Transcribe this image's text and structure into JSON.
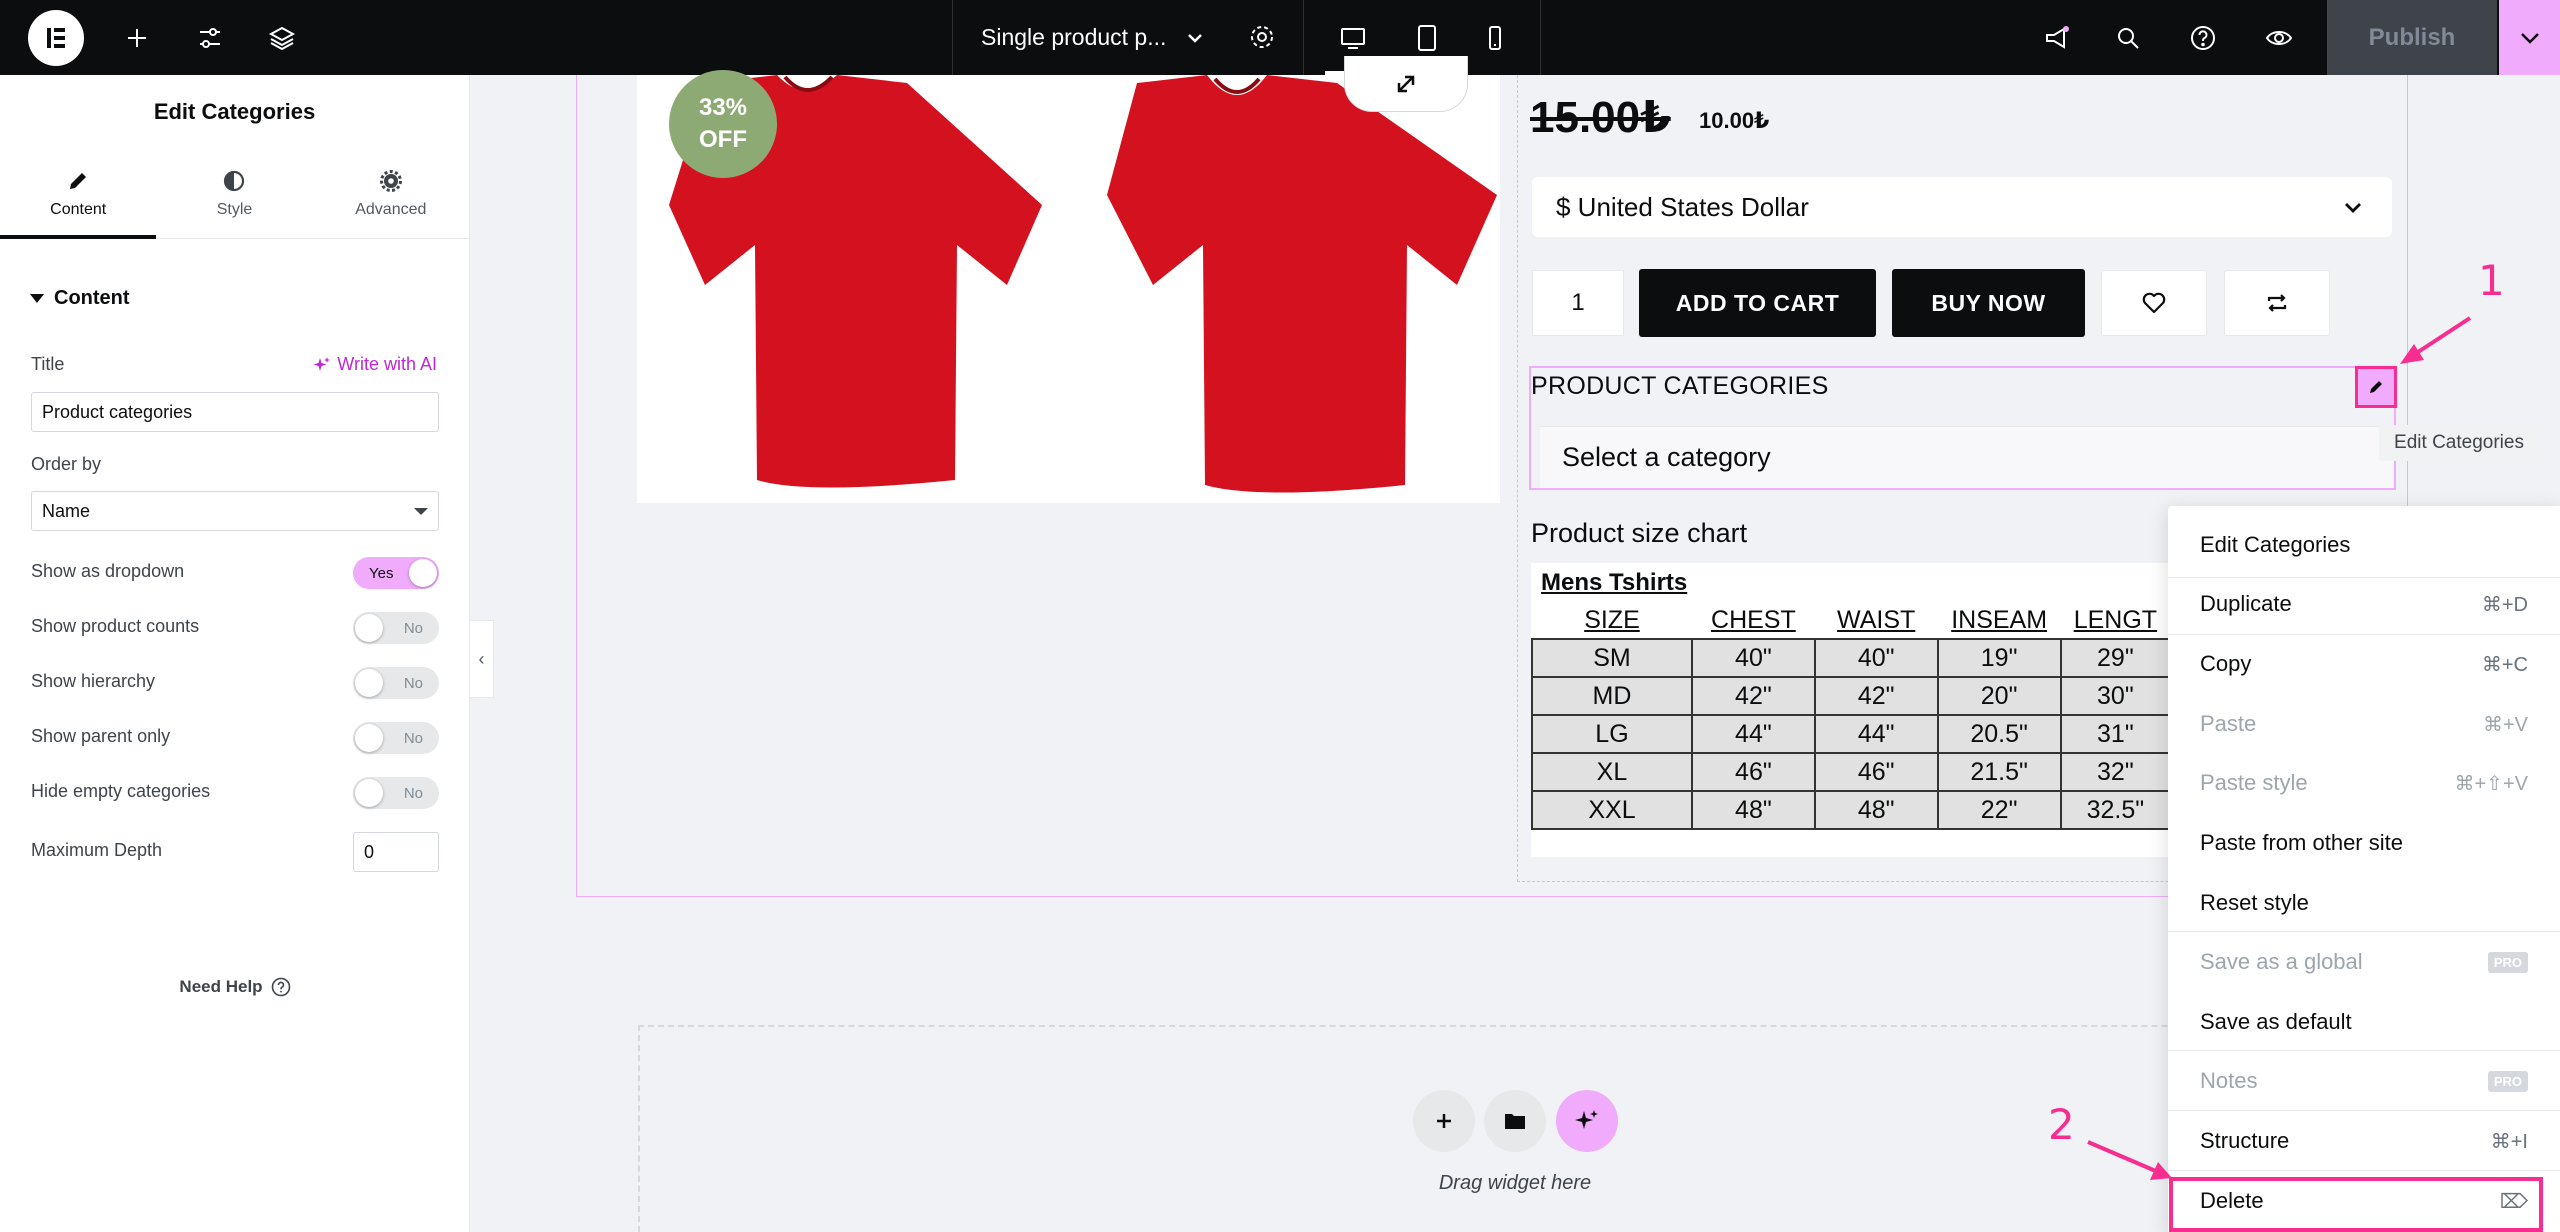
{
  "topbar": {
    "document_title": "Single product p...",
    "publish_label": "Publish",
    "icons": [
      "elementor-logo-icon",
      "add-icon",
      "sliders-icon",
      "layers-icon",
      "chevron-down-icon",
      "gear-icon",
      "desktop-icon",
      "tablet-icon",
      "mobile-icon",
      "megaphone-icon",
      "search-icon",
      "help-icon",
      "eye-icon",
      "chevron-down-icon"
    ],
    "colors": {
      "bg": "#0c0d0e",
      "publish_more": "#f0abfc"
    }
  },
  "panel": {
    "title": "Edit Categories",
    "tabs": [
      {
        "label": "Content",
        "icon": "pencil-icon",
        "active": true
      },
      {
        "label": "Style",
        "icon": "contrast-icon",
        "active": false
      },
      {
        "label": "Advanced",
        "icon": "gear-icon",
        "active": false
      }
    ],
    "section": "Content",
    "title_label": "Title",
    "ai_label": "Write with AI",
    "title_value": "Product categories",
    "order_label": "Order by",
    "order_value": "Name",
    "toggles": [
      {
        "label": "Show as dropdown",
        "value": "Yes",
        "on": true
      },
      {
        "label": "Show product counts",
        "value": "No",
        "on": false
      },
      {
        "label": "Show hierarchy",
        "value": "No",
        "on": false
      },
      {
        "label": "Show parent only",
        "value": "No",
        "on": false
      },
      {
        "label": "Hide empty categories",
        "value": "No",
        "on": false
      }
    ],
    "depth_label": "Maximum Depth",
    "depth_value": "0",
    "help_label": "Need Help",
    "collapse_glyph": "‹"
  },
  "product": {
    "badge_line1": "33%",
    "badge_line2": "OFF",
    "price_old": "15.00₺",
    "price_new": "10.00₺",
    "currency": "$ United States Dollar",
    "qty": "1",
    "add_to_cart": "ADD TO CART",
    "buy_now": "BUY NOW",
    "categories_title": "PRODUCT CATEGORIES",
    "categories_placeholder": "Select a category",
    "edit_tooltip": "Edit Categories",
    "size_chart_title": "Product size chart",
    "size_chart_heading": "Mens Tshirts",
    "size_table": {
      "headers": [
        "SIZE",
        "CHEST",
        "WAIST",
        "INSEAM",
        "LENGT"
      ],
      "rows": [
        [
          "SM",
          "40\"",
          "40\"",
          "19\"",
          "29\""
        ],
        [
          "MD",
          "42\"",
          "42\"",
          "20\"",
          "30\""
        ],
        [
          "LG",
          "44\"",
          "44\"",
          "20.5\"",
          "31\""
        ],
        [
          "XL",
          "46\"",
          "46\"",
          "21.5\"",
          "32\""
        ],
        [
          "XXL",
          "48\"",
          "48\"",
          "22\"",
          "32.5\""
        ]
      ]
    },
    "drag_text": "Drag widget here"
  },
  "context_menu": {
    "items": [
      {
        "label": "Edit Categories",
        "shortcut": "",
        "disabled": false
      },
      {
        "label": "Duplicate",
        "shortcut": "⌘+D",
        "disabled": false
      },
      {
        "label": "Copy",
        "shortcut": "⌘+C",
        "disabled": false
      },
      {
        "label": "Paste",
        "shortcut": "⌘+V",
        "disabled": true
      },
      {
        "label": "Paste style",
        "shortcut": "⌘+⇧+V",
        "disabled": true
      },
      {
        "label": "Paste from other site",
        "shortcut": "",
        "disabled": false
      },
      {
        "label": "Reset style",
        "shortcut": "",
        "disabled": false
      },
      {
        "label": "Save as a global",
        "shortcut": "",
        "badge": "PRO",
        "disabled": true
      },
      {
        "label": "Save as default",
        "shortcut": "",
        "disabled": false
      },
      {
        "label": "Notes",
        "shortcut": "",
        "badge": "PRO",
        "disabled": true
      },
      {
        "label": "Structure",
        "shortcut": "⌘+I",
        "disabled": false
      },
      {
        "label": "Delete",
        "shortcut": "⌦",
        "disabled": false
      }
    ]
  },
  "annotations": {
    "step1": "1",
    "step2": "2",
    "color": "#f72d8f"
  }
}
